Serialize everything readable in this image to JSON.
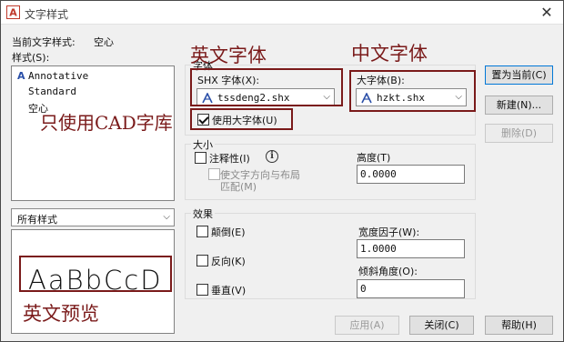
{
  "window": {
    "title": "文字样式",
    "close_glyph": "✕"
  },
  "current_style": {
    "label": "当前文字样式:",
    "value": "空心"
  },
  "styles": {
    "label": "样式(S):",
    "items": [
      {
        "name": "Annotative",
        "icon": "annotative-icon",
        "icon_glyph": "A"
      },
      {
        "name": "Standard"
      },
      {
        "name": "空心"
      }
    ]
  },
  "style_filter": {
    "value": "所有样式"
  },
  "preview": {
    "text": "AaBbCcD"
  },
  "font_group": {
    "title": "字体",
    "shx_label": "SHX 字体(X):",
    "shx_value": "tssdeng2.shx",
    "bigfont_label": "大字体(B):",
    "bigfont_value": "hzkt.shx",
    "use_bigfont_label": "使用大字体(U)",
    "use_bigfont_checked": true
  },
  "size_group": {
    "title": "大小",
    "annotative_label": "注释性(I)",
    "annotative_checked": false,
    "match_orient_line1": "使文字方向与布局",
    "match_orient_line2": "匹配(M)",
    "height_label": "高度(T)",
    "height_value": "0.0000"
  },
  "effects_group": {
    "title": "效果",
    "upside_down_label": "颠倒(E)",
    "backwards_label": "反向(K)",
    "vertical_label": "垂直(V)",
    "width_factor_label": "宽度因子(W):",
    "width_factor_value": "1.0000",
    "oblique_label": "倾斜角度(O):",
    "oblique_value": "0"
  },
  "buttons": {
    "set_current": "置为当前(C)",
    "new": "新建(N)...",
    "delete": "删除(D)",
    "apply": "应用(A)",
    "close": "关闭(C)",
    "help": "帮助(H)"
  },
  "annotations": {
    "english_font": "英文字体",
    "chinese_font": "中文字体",
    "cad_only": "只使用CAD字库",
    "english_preview": "英文预览",
    "color": "#7a1a1a"
  }
}
